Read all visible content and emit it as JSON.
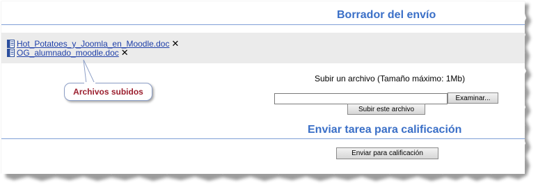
{
  "draft_section": {
    "title": "Borrador del envío"
  },
  "files": [
    {
      "name": "Hot_Potatoes_y_Joomla_en_Moodle.doc",
      "delete_icon": "close-x-icon",
      "icon": "word-doc-icon"
    },
    {
      "name": "OG_alumnado_moodle.doc",
      "delete_icon": "close-x-icon",
      "icon": "word-doc-icon"
    }
  ],
  "callout": {
    "text": "Archivos subidos"
  },
  "upload": {
    "label": "Subir un archivo (Tamaño máximo: 1Mb)",
    "file_value": "",
    "browse_label": "Examinar...",
    "submit_label": "Subir este archivo"
  },
  "send_section": {
    "title": "Enviar tarea para calificación",
    "button_label": "Enviar para calificación"
  },
  "colors": {
    "title_blue": "#3a6fc7",
    "link_blue": "#1e3fa8",
    "callout_red": "#9b1f2e",
    "band_gray": "#ebebeb"
  }
}
